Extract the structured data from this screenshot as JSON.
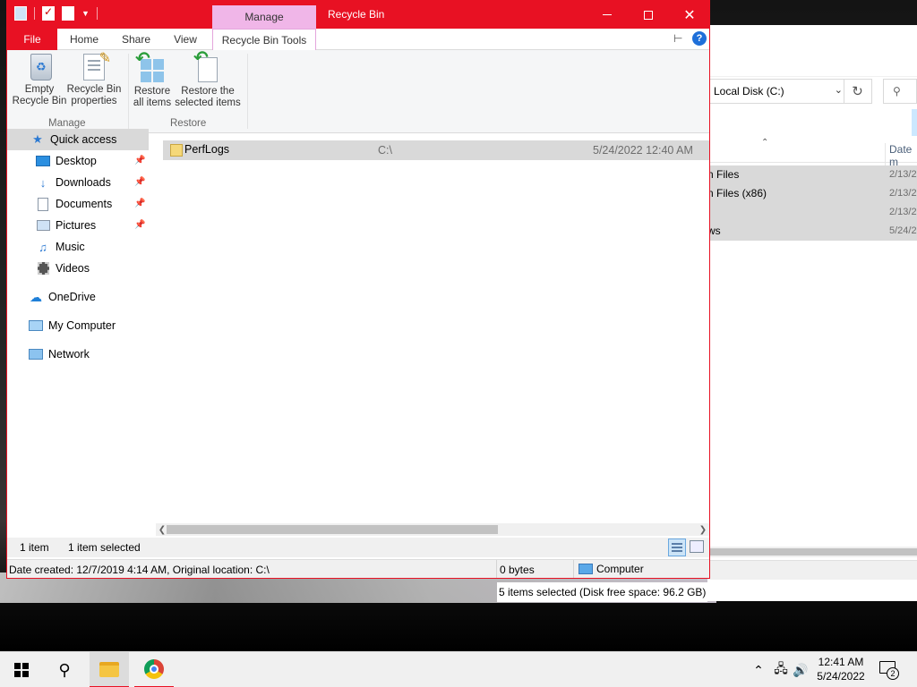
{
  "window": {
    "title": "Recycle Bin",
    "context_tab_group": "Manage",
    "accent_color": "#e81123",
    "context_color": "#f0b6e8"
  },
  "tabs": {
    "file": "File",
    "home": "Home",
    "share": "Share",
    "view": "View",
    "recycle_bin_tools": "Recycle Bin Tools"
  },
  "ribbon": {
    "empty_recycle_bin": [
      "Empty",
      "Recycle Bin"
    ],
    "recycle_bin_properties": [
      "Recycle Bin",
      "properties"
    ],
    "restore_all_items": [
      "Restore",
      "all items"
    ],
    "restore_selected_items": [
      "Restore the",
      "selected items"
    ],
    "group_manage": "Manage",
    "group_restore": "Restore"
  },
  "nav": {
    "items": [
      {
        "label": "Quick access",
        "icon": "star-icon",
        "pinned": false,
        "selected": true
      },
      {
        "label": "Desktop",
        "icon": "desktop-icon",
        "pinned": true
      },
      {
        "label": "Downloads",
        "icon": "downloads-icon",
        "pinned": true
      },
      {
        "label": "Documents",
        "icon": "documents-icon",
        "pinned": true
      },
      {
        "label": "Pictures",
        "icon": "pictures-icon",
        "pinned": true
      },
      {
        "label": "Music",
        "icon": "music-icon",
        "pinned": false
      },
      {
        "label": "Videos",
        "icon": "videos-icon",
        "pinned": false
      },
      {
        "label": "OneDrive",
        "icon": "onedrive-icon"
      },
      {
        "label": "My Computer",
        "icon": "computer-icon"
      },
      {
        "label": "Network",
        "icon": "network-icon"
      }
    ]
  },
  "files": [
    {
      "name": "PerfLogs",
      "original_location": "C:\\",
      "date_deleted": "5/24/2022 12:40 AM"
    }
  ],
  "status": {
    "item_count": "1 item",
    "selected": "1 item selected",
    "details": "Date created: 12/7/2019 4:14 AM, Original location: C:\\",
    "size": "0 bytes",
    "location": "Computer"
  },
  "background_window": {
    "address": "Local Disk (C:)",
    "column_date": "Date m",
    "rows": [
      {
        "name": "n Files",
        "date": "2/13/2"
      },
      {
        "name": "n Files (x86)",
        "date": "2/13/2"
      },
      {
        "name": "",
        "date": "2/13/2"
      },
      {
        "name": "ws",
        "date": "5/24/2"
      }
    ],
    "status": "5 items selected (Disk free space: 96.2 GB)"
  },
  "taskbar": {
    "time": "12:41 AM",
    "date": "5/24/2022",
    "notification_count": "2"
  }
}
